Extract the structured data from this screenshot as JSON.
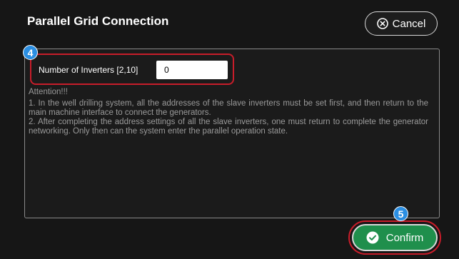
{
  "dialog": {
    "title": "Parallel Grid Connection",
    "cancel_label": "Cancel",
    "confirm_label": "Confirm"
  },
  "inverters": {
    "label": "Number of Inverters [2,10]",
    "value": "0"
  },
  "notice": {
    "heading": "Attention!!!",
    "lines": [
      "1. In the well drilling system, all the addresses of the slave inverters must be set first, and then return to the main machine interface to connect the generators.",
      "2. After completing the address settings of all the slave inverters, one must return to complete the generator networking. Only then can the system enter the parallel operation state."
    ]
  },
  "badges": {
    "inverters_step": "4",
    "confirm_step": "5"
  },
  "colors": {
    "background": "#161616",
    "highlight_red": "#c81d2a",
    "badge_blue": "#2b8fe3",
    "confirm_green": "#1f8f4c"
  },
  "icons": {
    "cancel": "circle-x-icon",
    "confirm": "circle-check-icon"
  }
}
